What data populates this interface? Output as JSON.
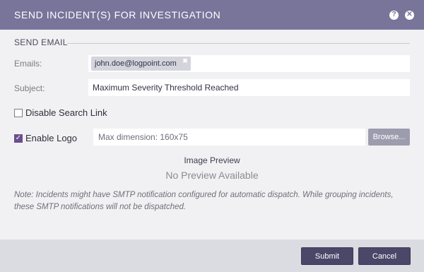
{
  "dialog": {
    "title": "SEND INCIDENT(S) FOR INVESTIGATION",
    "help_icon": "help-icon",
    "close_icon": "close-icon"
  },
  "section": {
    "title": "SEND EMAIL"
  },
  "emails": {
    "label": "Emails:",
    "chips": [
      {
        "value": "john.doe@logpoint.com",
        "remove": "✖"
      }
    ]
  },
  "subject": {
    "label": "Subject:",
    "value": "Maximum Severity Threshold Reached"
  },
  "disable_search_link": {
    "label": "Disable Search Link",
    "checked": false
  },
  "enable_logo": {
    "label": "Enable Logo",
    "checked": true,
    "placeholder": "Max dimension: 160x75",
    "browse_label": "Browse..."
  },
  "preview": {
    "title": "Image Preview",
    "empty_text": "No Preview Available"
  },
  "note": "Note: Incidents might have SMTP notification configured for automatic dispatch. While grouping incidents, these SMTP notifications will not be dispatched.",
  "footer": {
    "submit_label": "Submit",
    "cancel_label": "Cancel"
  },
  "colors": {
    "header": "#78749a",
    "primary_button": "#4a4768",
    "checkbox_checked": "#6b4e8e"
  }
}
